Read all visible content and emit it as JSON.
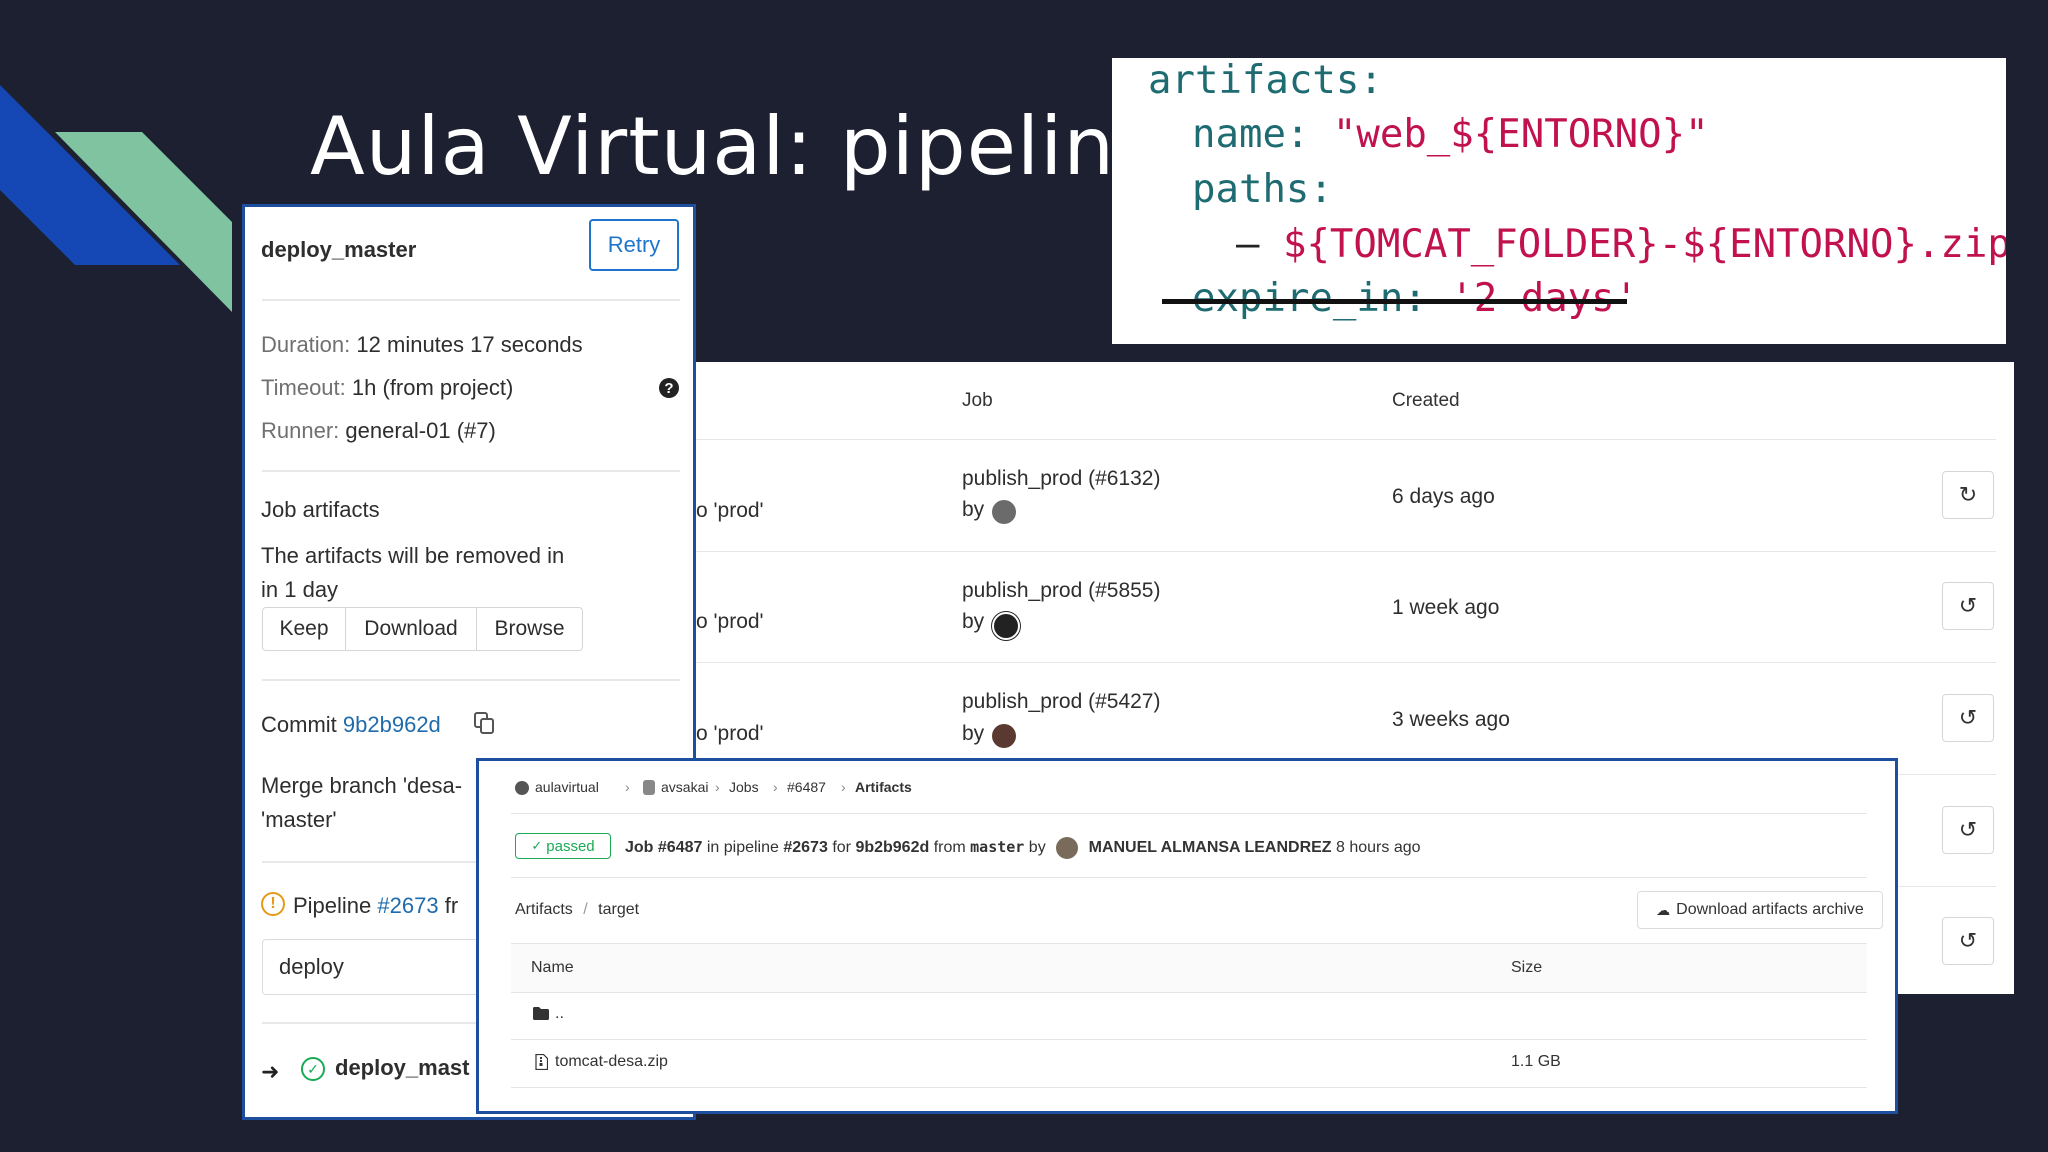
{
  "slide": {
    "title": "Aula Virtual: pipeline",
    "colors": {
      "background": "#1c2030",
      "stripe_blue": "#1547b5",
      "stripe_green": "#7fc3a0",
      "panel_border": "#1e4f9e"
    }
  },
  "code": {
    "line1": "artifacts:",
    "line2_key": "name: ",
    "line2_val": "\"web_${ENTORNO}\"",
    "line3": "paths:",
    "line4_dash": "– ",
    "line4_val": "${TOMCAT_FOLDER}-${ENTORNO}.zip",
    "line5_key": "expire_in: ",
    "line5_val": "'2 days'"
  },
  "jobs_table": {
    "headers": {
      "job": "Job",
      "created": "Created"
    },
    "rows": [
      {
        "stage_fragment": "o 'prod'",
        "job": "publish_prod (#6132)",
        "by": "by",
        "created": "6 days ago",
        "action_icon": "refresh-icon"
      },
      {
        "stage_fragment": "o 'prod'",
        "job": "publish_prod (#5855)",
        "by": "by",
        "created": "1 week ago",
        "action_icon": "rollback-icon"
      },
      {
        "stage_fragment": "o 'prod'",
        "job": "publish_prod (#5427)",
        "by": "by",
        "created": "3 weeks ago",
        "action_icon": "rollback-icon"
      }
    ]
  },
  "job_sidebar": {
    "job_name": "deploy_master",
    "retry_label": "Retry",
    "duration_label": "Duration:",
    "duration_value": "12 minutes 17 seconds",
    "timeout_label": "Timeout:",
    "timeout_value": "1h (from project)",
    "runner_label": "Runner:",
    "runner_value": "general-01 (#7)",
    "artifacts_heading": "Job artifacts",
    "artifacts_note_1": "The artifacts will be removed in",
    "artifacts_note_2": "in 1 day",
    "keep_label": "Keep",
    "download_label": "Download",
    "browse_label": "Browse",
    "commit_label": "Commit",
    "commit_sha": "9b2b962d",
    "merge_1": "Merge branch 'desa-",
    "merge_2": "'master'",
    "pipeline_label": "Pipeline",
    "pipeline_id": "#2673",
    "pipeline_from": "fr",
    "stage_value": "deploy",
    "current_job": "deploy_mast"
  },
  "artifacts_browser": {
    "breadcrumb": [
      "aulavirtual",
      "avsakai",
      "Jobs",
      "#6487",
      "Artifacts"
    ],
    "status_badge": "passed",
    "job_ref": "Job #6487",
    "in_pipeline": "in pipeline",
    "pipeline_ref": "#2673",
    "for": "for",
    "commit_ref": "9b2b962d",
    "from": "from",
    "branch": "master",
    "by": "by",
    "author": "MANUEL ALMANSA LEANDREZ",
    "time": "8 hours ago",
    "path_root": "Artifacts",
    "path_sep": "/",
    "path_dir": "target",
    "download_archive_label": "Download artifacts archive",
    "col_name": "Name",
    "col_size": "Size",
    "files": [
      {
        "name": "..",
        "size": "",
        "icon": "folder-icon"
      },
      {
        "name": "tomcat-desa.zip",
        "size": "1.1 GB",
        "icon": "file-archive-icon"
      }
    ]
  }
}
